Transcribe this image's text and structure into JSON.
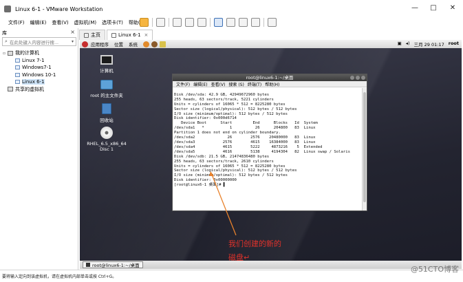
{
  "window": {
    "title": "Linux 6-1 - VMware Workstation",
    "controls": [
      "—",
      "□",
      "✕"
    ]
  },
  "menu": [
    "文件(F)",
    "编辑(E)",
    "查看(V)",
    "虚拟机(M)",
    "选项卡(T)",
    "帮助(H)"
  ],
  "library": {
    "title": "库",
    "close": "×",
    "search_placeholder": "在此处键入内容进行搜...",
    "tree": [
      {
        "label": "我的计算机",
        "level": 0
      },
      {
        "label": "Linux 7-1",
        "level": 1
      },
      {
        "label": "Windows7-1",
        "level": 1
      },
      {
        "label": "Windows 10-1",
        "level": 1
      },
      {
        "label": "Linux 6-1",
        "level": 1,
        "selected": true
      },
      {
        "label": "共享的虚拟机",
        "level": 0
      }
    ]
  },
  "tabs": [
    {
      "label": "主页"
    },
    {
      "label": "Linux 6-1",
      "close": "×"
    }
  ],
  "guest": {
    "panel_menu": [
      "应用程序",
      "位置",
      "系统"
    ],
    "clock": "三月 29 01:17",
    "user": "root",
    "desktop_icons": [
      {
        "label": "计算机"
      },
      {
        "label": "root 的主文件夹"
      },
      {
        "label": "回收站"
      },
      {
        "label": "RHEL_6.5_x86_64 Disc 1"
      }
    ],
    "taskbar_item": "root@linux6-1:~/桌面"
  },
  "terminal": {
    "title": "root@linux6-1:~/桌面",
    "menu": [
      "文件(F)",
      "编辑(E)",
      "查看(V)",
      "搜索 (S)",
      "终端(T)",
      "帮助(H)"
    ],
    "lines": [
      "Disk /dev/sda: 42.9 GB, 42949672960 bytes",
      "255 heads, 63 sectors/track, 5221 cylinders",
      "Units = cylinders of 16065 * 512 = 8225280 bytes",
      "Sector size (logical/physical): 512 bytes / 512 bytes",
      "I/O size (minimum/optimal): 512 bytes / 512 bytes",
      "Disk identifier: 0x000d6714",
      "",
      "   Device Boot      Start         End      Blocks   Id  System",
      "/dev/sda1   *           1          26      204800   83  Linux",
      "Partition 1 does not end on cylinder boundary.",
      "/dev/sda2              26        2576    20480000   83  Linux",
      "/dev/sda3            2576        4615    16384000   83  Linux",
      "/dev/sda4            4615        5222     4873216    5  Extended",
      "/dev/sda5            4616        5138     4194304   82  Linux swap / Solaris",
      "",
      "Disk /dev/sdb: 21.5 GB, 21474836480 bytes",
      "255 heads, 63 sectors/track, 2610 cylinders",
      "Units = cylinders of 16065 * 512 = 8225280 bytes",
      "Sector size (logical/physical): 512 bytes / 512 bytes",
      "I/O size (minimum/optimal): 512 bytes / 512 bytes",
      "Disk identifier: 0x00000000",
      "",
      "[root@linux6-1 桌面]# ▌"
    ]
  },
  "annotation": {
    "line1": "我们创建的新的",
    "line2": "磁盘↵",
    "color": "#e0322b"
  },
  "status_bar": "要将输入定向到该虚拟机，请在虚拟机内部单击或按 Ctrl+G。",
  "watermark": "@51CTO博客"
}
